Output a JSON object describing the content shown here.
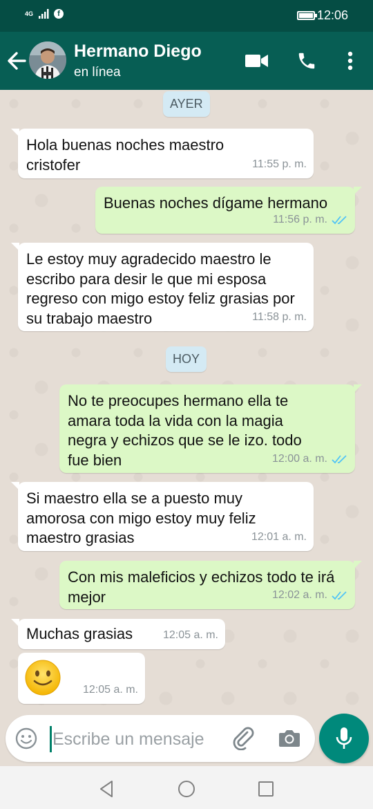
{
  "status_bar": {
    "network": "4G",
    "time": "12:06"
  },
  "header": {
    "contact_name": "Hermano Diego",
    "contact_status": "en línea"
  },
  "day_labels": [
    "AYER",
    "HOY"
  ],
  "messages": [
    {
      "dir": "in",
      "text": "Hola buenas noches maestro cristofer",
      "time": "11:55 p. m."
    },
    {
      "dir": "out",
      "text": "Buenas noches dígame hermano",
      "time": "11:56 p. m.",
      "status": "read"
    },
    {
      "dir": "in",
      "text": "Le estoy muy agradecido maestro le escribo para desir le que mi esposa regreso con migo estoy feliz grasias por su trabajo maestro",
      "time": "11:58 p. m."
    },
    {
      "dir": "out",
      "text": "No te preocupes hermano ella te amara toda la vida con la magia negra y echizos que se le izo. todo fue bien",
      "time": "12:00 a. m.",
      "status": "read"
    },
    {
      "dir": "in",
      "text": "Si maestro ella se a puesto muy amorosa con migo estoy muy feliz maestro grasias",
      "time": "12:01 a. m."
    },
    {
      "dir": "out",
      "text": "Con mis maleficios y echizos todo te irá mejor",
      "time": "12:02 a. m.",
      "status": "read"
    },
    {
      "dir": "in",
      "text": "Muchas grasias",
      "time": "12:05 a. m."
    },
    {
      "dir": "in",
      "emoji": "slightly-smiling-face",
      "time": "12:05 a. m."
    }
  ],
  "composer": {
    "placeholder": "Escribe un mensaje"
  },
  "colors": {
    "header": "#075e54",
    "status_bar": "#054d44",
    "outgoing": "#dcf8c6",
    "incoming": "#ffffff",
    "accent": "#00897b",
    "read_ticks": "#4fc3f7"
  }
}
